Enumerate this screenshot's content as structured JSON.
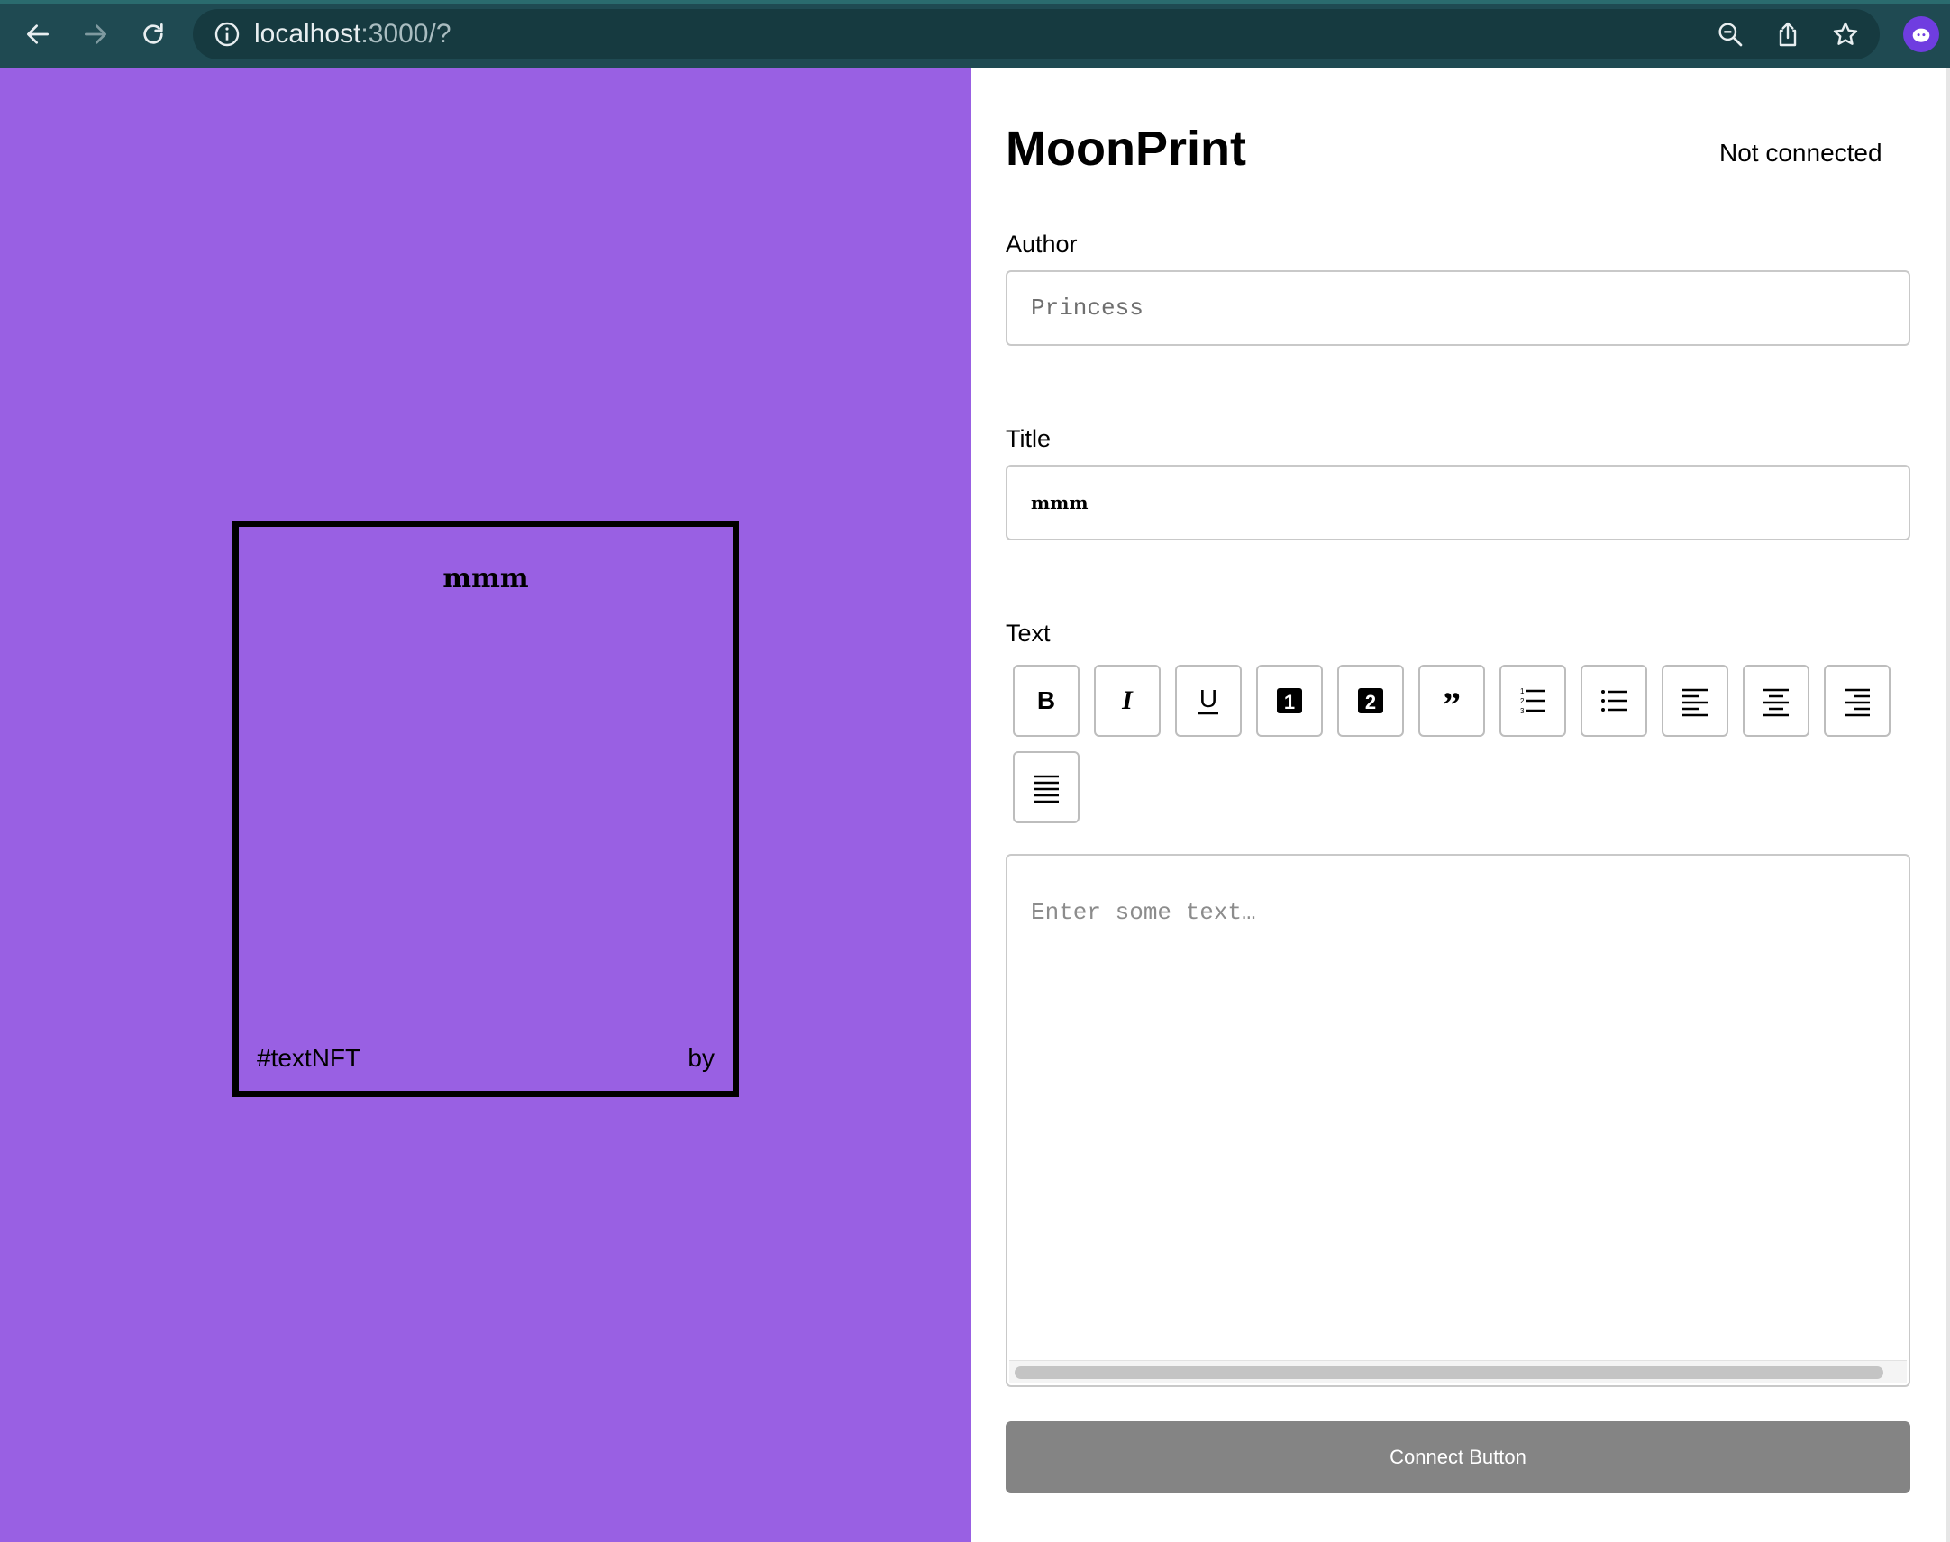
{
  "browser": {
    "url_host": "localhost",
    "url_path": ":3000/?",
    "icons": [
      "back-icon",
      "forward-icon",
      "reload-icon",
      "info-icon",
      "zoom-out-icon",
      "share-icon",
      "star-icon",
      "extension-icon"
    ]
  },
  "preview": {
    "background": "#9960e3",
    "card_title": "mmm",
    "tag": "#textNFT",
    "by": "by"
  },
  "editor": {
    "brand": "MoonPrint",
    "connection_status": "Not connected",
    "author": {
      "label": "Author",
      "placeholder": "Princess",
      "value": ""
    },
    "title": {
      "label": "Title",
      "value": "mmm"
    },
    "text": {
      "label": "Text",
      "placeholder": "Enter some text…"
    },
    "toolbar": [
      {
        "name": "bold",
        "glyph": "B"
      },
      {
        "name": "italic",
        "glyph": "I"
      },
      {
        "name": "underline",
        "glyph": "U"
      },
      {
        "name": "heading-one",
        "glyph": "1"
      },
      {
        "name": "heading-two",
        "glyph": "2"
      },
      {
        "name": "block-quote",
        "glyph": "”"
      },
      {
        "name": "numbered-list",
        "glyph": ""
      },
      {
        "name": "bulleted-list",
        "glyph": ""
      },
      {
        "name": "align-left",
        "glyph": ""
      },
      {
        "name": "align-center",
        "glyph": ""
      },
      {
        "name": "align-right",
        "glyph": ""
      },
      {
        "name": "align-justify",
        "glyph": ""
      }
    ],
    "connect_button": "Connect Button",
    "connect_button_color": "#848484"
  }
}
